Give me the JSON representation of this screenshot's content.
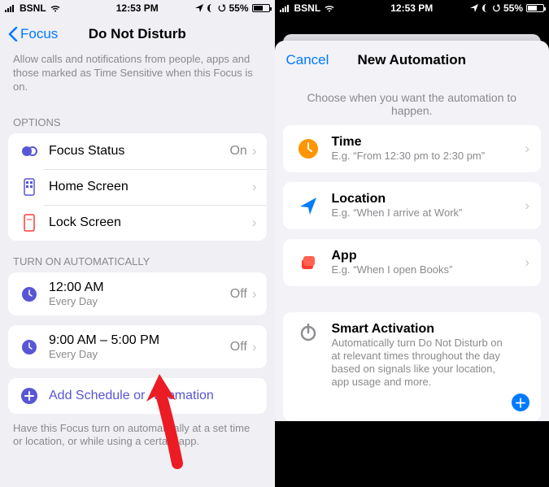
{
  "status": {
    "carrier": "BSNL",
    "time": "12:53 PM",
    "battery": "55%"
  },
  "left": {
    "back_label": "Focus",
    "title": "Do Not Disturb",
    "truncated_top": "Allow calls and notifications from people, apps and those marked as Time Sensitive when this Focus is on.",
    "options_header": "OPTIONS",
    "options": [
      {
        "label": "Focus Status",
        "value": "On"
      },
      {
        "label": "Home Screen",
        "value": ""
      },
      {
        "label": "Lock Screen",
        "value": ""
      }
    ],
    "auto_header": "TURN ON AUTOMATICALLY",
    "schedules": [
      {
        "time": "12:00 AM",
        "sub": "Every Day",
        "value": "Off"
      },
      {
        "time": "9:00 AM – 5:00 PM",
        "sub": "Every Day",
        "value": "Off"
      }
    ],
    "add_label": "Add Schedule or Automation",
    "footer": "Have this Focus turn on automatically at a set time or location, or while using a certain app."
  },
  "right": {
    "cancel": "Cancel",
    "title": "New Automation",
    "hint": "Choose when you want the automation to happen.",
    "items": [
      {
        "title": "Time",
        "sub": "E.g. “From 12:30 pm to 2:30 pm”"
      },
      {
        "title": "Location",
        "sub": "E.g. “When I arrive at Work”"
      },
      {
        "title": "App",
        "sub": "E.g. “When I open Books”"
      }
    ],
    "smart": {
      "title": "Smart Activation",
      "sub": "Automatically turn Do Not Disturb on at relevant times throughout the day based on signals like your location, app usage and more."
    }
  }
}
